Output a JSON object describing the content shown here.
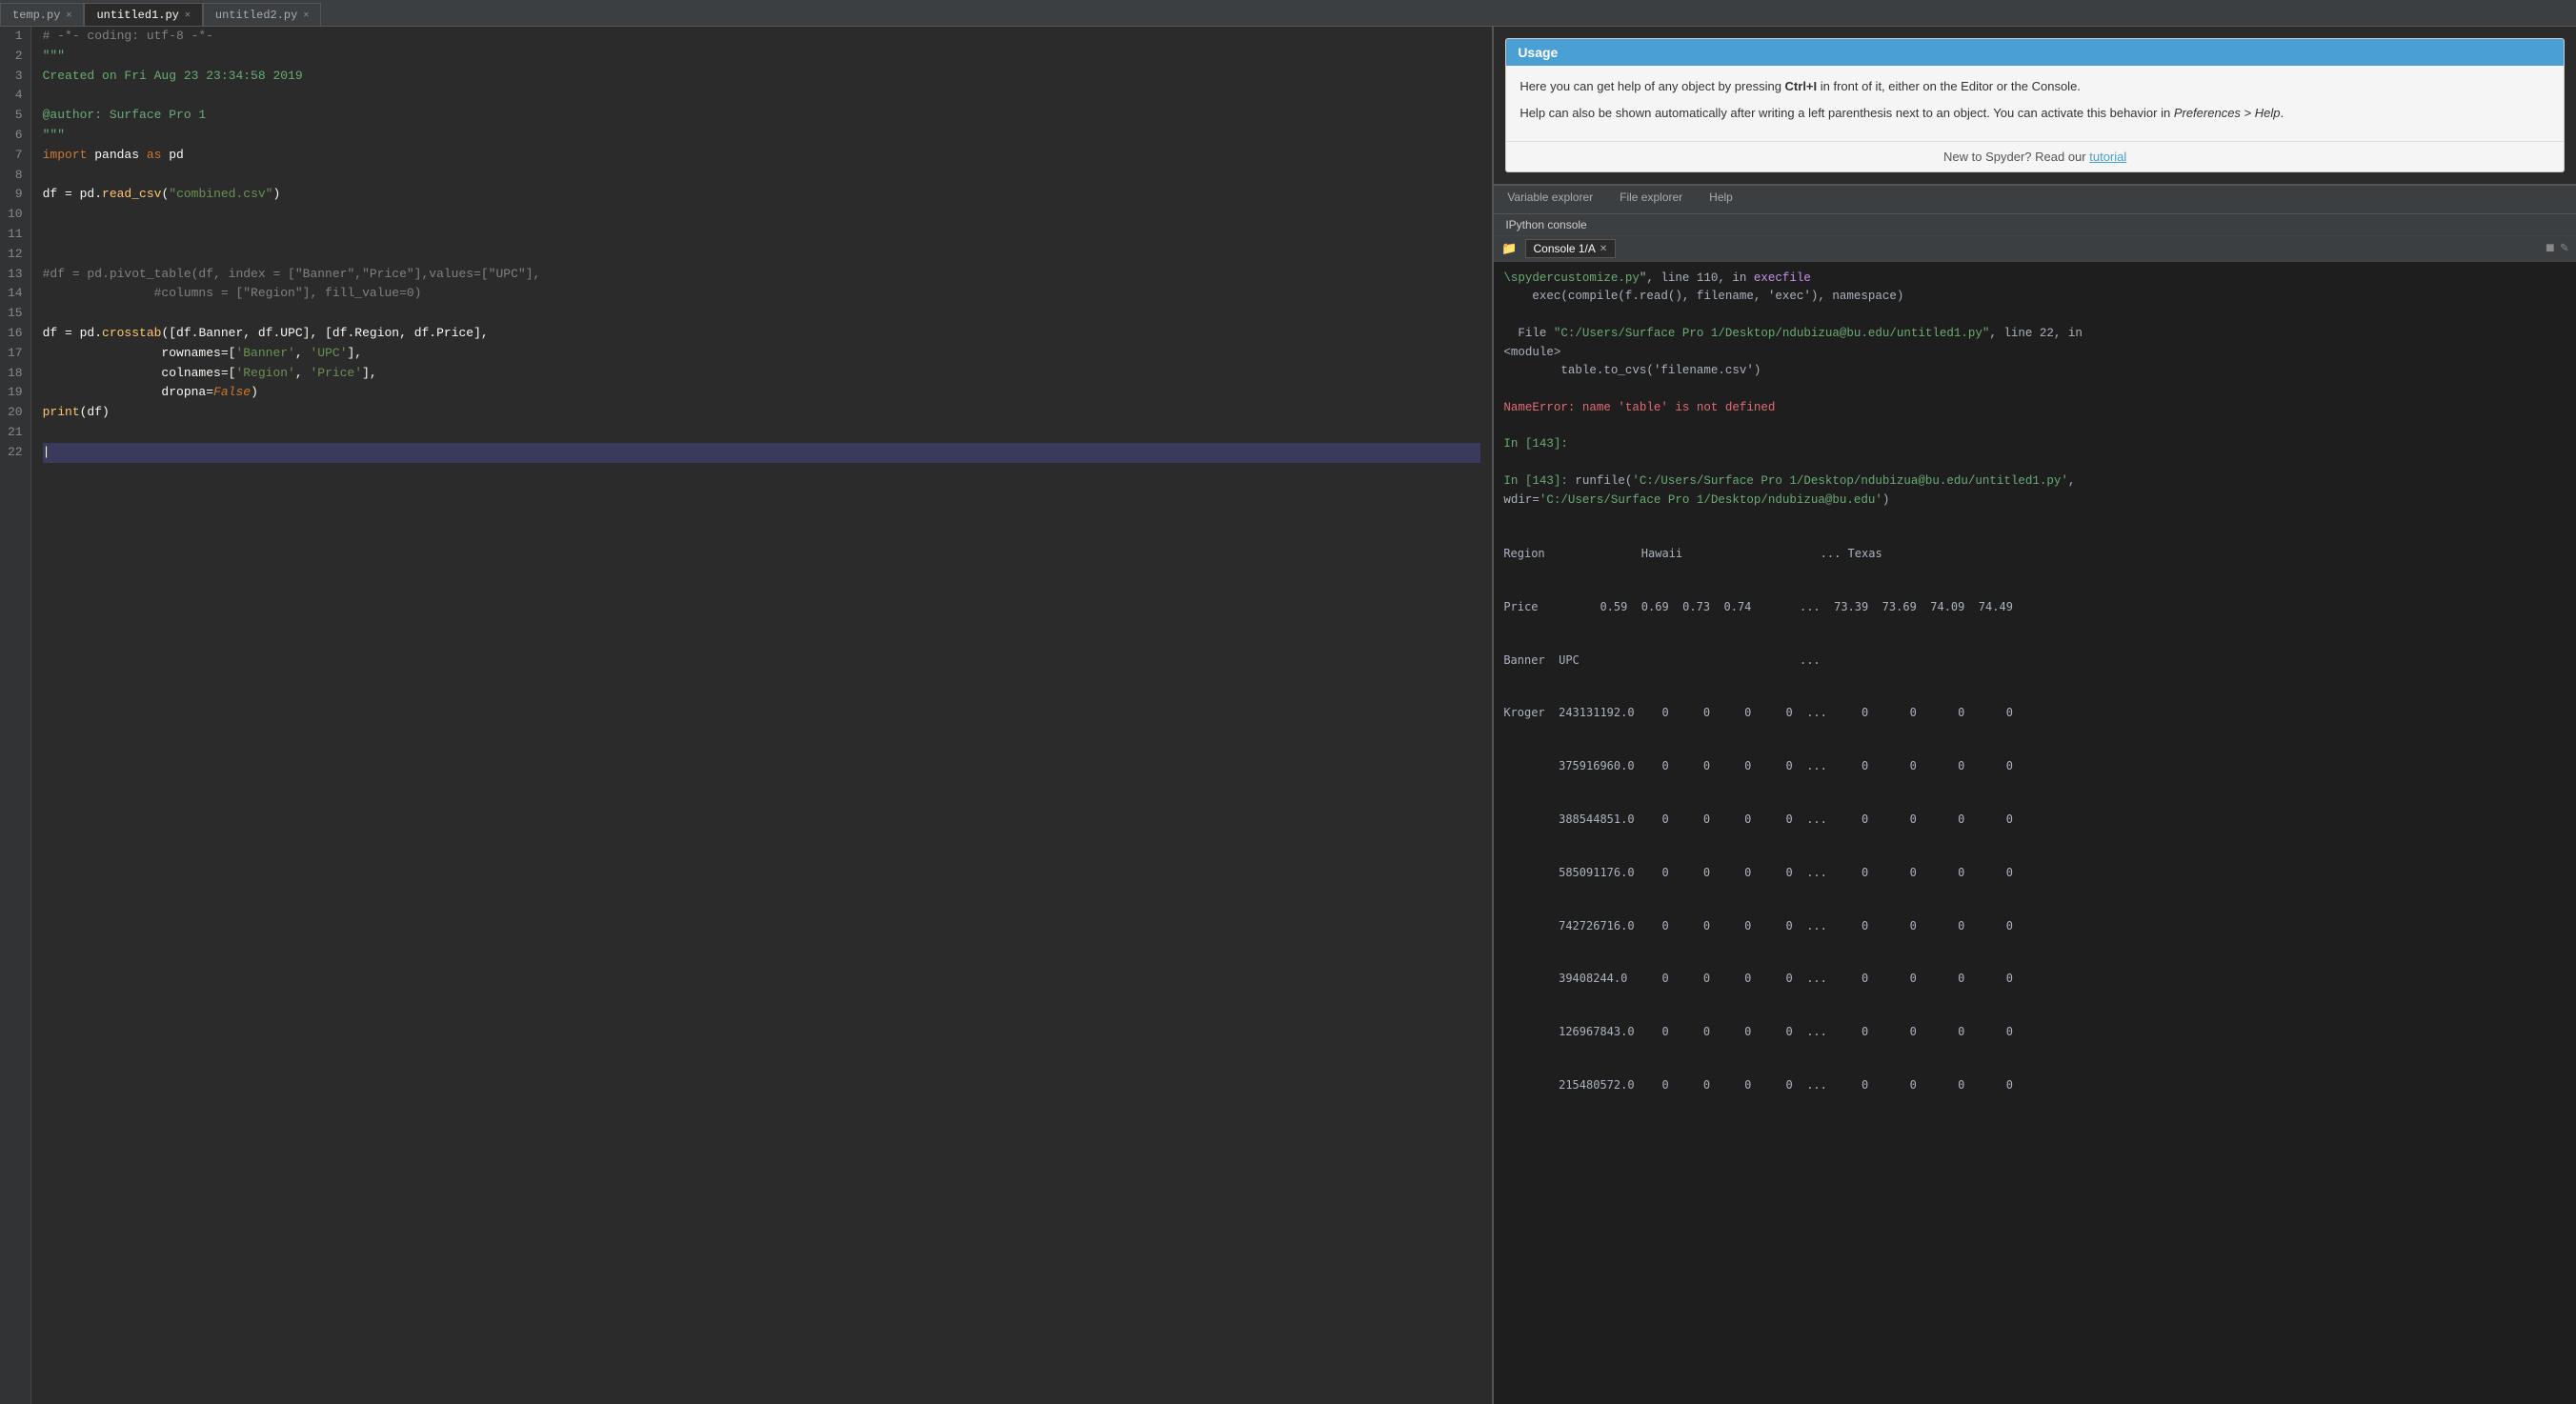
{
  "tabs": [
    {
      "label": "temp.py",
      "active": false,
      "closeable": true
    },
    {
      "label": "untitled1.py",
      "active": true,
      "closeable": true
    },
    {
      "label": "untitled2.py",
      "active": false,
      "closeable": true
    }
  ],
  "editor": {
    "lines": [
      {
        "num": 1,
        "text": "# -*- coding: utf-8 -*-",
        "type": "comment"
      },
      {
        "num": 2,
        "text": "\"\"\"",
        "type": "string"
      },
      {
        "num": 3,
        "text": "Created on Fri Aug 23 23:34:58 2019",
        "type": "string_content"
      },
      {
        "num": 4,
        "text": "",
        "type": "normal"
      },
      {
        "num": 5,
        "text": "@author: Surface Pro 1",
        "type": "string_content"
      },
      {
        "num": 6,
        "text": "\"\"\"",
        "type": "string"
      },
      {
        "num": 7,
        "text": "import pandas as pd",
        "type": "code"
      },
      {
        "num": 8,
        "text": "",
        "type": "normal"
      },
      {
        "num": 9,
        "text": "df = pd.read_csv(\"combined.csv\")",
        "type": "code"
      },
      {
        "num": 10,
        "text": "",
        "type": "normal"
      },
      {
        "num": 11,
        "text": "",
        "type": "normal"
      },
      {
        "num": 12,
        "text": "",
        "type": "normal"
      },
      {
        "num": 13,
        "text": "#df = pd.pivot_table(df, index = [\"Banner\",\"Price\"],values=[\"UPC\"],",
        "type": "comment"
      },
      {
        "num": 14,
        "text": "               #columns = [\"Region\"], fill_value=0)",
        "type": "comment"
      },
      {
        "num": 15,
        "text": "",
        "type": "normal"
      },
      {
        "num": 16,
        "text": "df = pd.crosstab([df.Banner, df.UPC], [df.Region, df.Price],",
        "type": "code"
      },
      {
        "num": 17,
        "text": "                rownames=['Banner', 'UPC'],",
        "type": "code"
      },
      {
        "num": 18,
        "text": "                colnames=['Region', 'Price'],",
        "type": "code"
      },
      {
        "num": 19,
        "text": "                dropna=False)",
        "type": "code"
      },
      {
        "num": 20,
        "text": "print(df)",
        "type": "code"
      },
      {
        "num": 21,
        "text": "",
        "type": "normal"
      },
      {
        "num": 22,
        "text": "",
        "type": "highlighted"
      }
    ]
  },
  "usage": {
    "title": "Usage",
    "para1_pre": "Here you can get help of any object by pressing ",
    "para1_bold": "Ctrl+I",
    "para1_post": " in front of it, either on the Editor or the Console.",
    "para2": "Help can also be shown automatically after writing a left parenthesis next to an object. You can activate this behavior in ",
    "para2_italic": "Preferences > Help",
    "para2_end": ".",
    "footer_pre": "New to Spyder? Read our ",
    "footer_link": "tutorial"
  },
  "panel_tabs": [
    {
      "label": "Variable explorer",
      "active": false
    },
    {
      "label": "File explorer",
      "active": false
    },
    {
      "label": "Help",
      "active": false
    }
  ],
  "console": {
    "label": "IPython console",
    "tab_label": "Console 1/A",
    "output": [
      {
        "text": "\\spydercustomize.py\", line 110, in execfile",
        "type": "mixed_green_purple"
      },
      {
        "text": "    exec(compile(f.read(), filename, 'exec'), namespace)",
        "type": "normal"
      },
      {
        "text": "",
        "type": "normal"
      },
      {
        "text": "  File \"C:/Users/Surface Pro 1/Desktop/ndubizua@bu.edu/untitled1.py\", line 22, in",
        "type": "mixed_file"
      },
      {
        "text": "<module>",
        "type": "normal"
      },
      {
        "text": "        table.to_cvs('filename.csv')",
        "type": "normal_indent"
      },
      {
        "text": "",
        "type": "normal"
      },
      {
        "text": "NameError: name 'table' is not defined",
        "type": "error"
      },
      {
        "text": "",
        "type": "normal"
      },
      {
        "text": "In [143]:",
        "type": "prompt"
      },
      {
        "text": "",
        "type": "normal"
      },
      {
        "text": "In [143]: runfile('C:/Users/Surface Pro 1/Desktop/ndubizua@bu.edu/untitled1.py',",
        "type": "runfile"
      },
      {
        "text": "wdir='C:/Users/Surface Pro 1/Desktop/ndubizua@bu.edu')",
        "type": "normal"
      },
      {
        "text": "Region              Hawaii                    ... Texas",
        "type": "table_header"
      },
      {
        "text": "Price         0.59  0.69  0.73  0.74       ...  73.39  73.69  74.09  74.49",
        "type": "table_header"
      },
      {
        "text": "Banner  UPC                                ...",
        "type": "table_header"
      },
      {
        "text": "Kroger  243131192.0    0     0     0     0  ...     0      0      0      0",
        "type": "table_row"
      },
      {
        "text": "        375916960.0    0     0     0     0  ...     0      0      0      0",
        "type": "table_row"
      },
      {
        "text": "        388544851.0    0     0     0     0  ...     0      0      0      0",
        "type": "table_row"
      },
      {
        "text": "        585091176.0    0     0     0     0  ...     0      0      0      0",
        "type": "table_row"
      },
      {
        "text": "        742726716.0    0     0     0     0  ...     0      0      0      0",
        "type": "table_row"
      },
      {
        "text": "        39408244.0     0     0     0     0  ...     0      0      0      0",
        "type": "table_row"
      },
      {
        "text": "        126967843.0    0     0     0     0  ...     0      0      0      0",
        "type": "table_row"
      },
      {
        "text": "        215480572.0    0     0     0     0  ...     0      0      0      0",
        "type": "table_row"
      }
    ]
  }
}
